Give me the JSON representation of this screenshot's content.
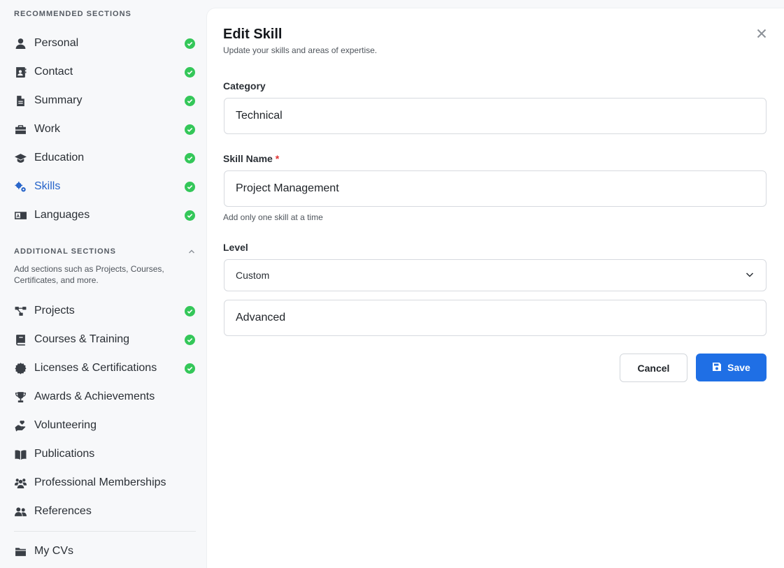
{
  "sidebar": {
    "recommended_heading": "RECOMMENDED SECTIONS",
    "recommended": [
      {
        "label": "Personal",
        "icon": "user-icon",
        "done": true
      },
      {
        "label": "Contact",
        "icon": "contact-card-icon",
        "done": true
      },
      {
        "label": "Summary",
        "icon": "document-icon",
        "done": true
      },
      {
        "label": "Work",
        "icon": "briefcase-icon",
        "done": true
      },
      {
        "label": "Education",
        "icon": "graduation-cap-icon",
        "done": true
      },
      {
        "label": "Skills",
        "icon": "gears-icon",
        "done": true,
        "active": true
      },
      {
        "label": "Languages",
        "icon": "language-icon",
        "done": true
      }
    ],
    "additional_heading": "ADDITIONAL SECTIONS",
    "additional_description": "Add sections such as Projects, Courses, Certificates, and more.",
    "additional": [
      {
        "label": "Projects",
        "icon": "project-diagram-icon",
        "done": true
      },
      {
        "label": "Courses & Training",
        "icon": "book-icon",
        "done": true
      },
      {
        "label": "Licenses & Certifications",
        "icon": "certificate-icon",
        "done": true
      },
      {
        "label": "Awards & Achievements",
        "icon": "trophy-icon",
        "done": false
      },
      {
        "label": "Volunteering",
        "icon": "hand-holding-heart-icon",
        "done": false
      },
      {
        "label": "Publications",
        "icon": "open-book-icon",
        "done": false
      },
      {
        "label": "Professional Memberships",
        "icon": "users-group-icon",
        "done": false
      },
      {
        "label": "References",
        "icon": "people-icon",
        "done": false
      }
    ],
    "footer_item": {
      "label": "My CVs",
      "icon": "folder-icon"
    }
  },
  "modal": {
    "title": "Edit Skill",
    "subtitle": "Update your skills and areas of expertise.",
    "category_label": "Category",
    "category_value": "Technical",
    "skill_name_label": "Skill Name",
    "required_marker": "*",
    "skill_name_value": "Project Management",
    "skill_hint": "Add only one skill at a time",
    "level_label": "Level",
    "level_select_value": "Custom",
    "level_custom_value": "Advanced",
    "cancel_label": "Cancel",
    "save_label": "Save"
  },
  "colors": {
    "accent": "#1f6fe5",
    "active_nav": "#2563c9",
    "check": "#34c759",
    "required": "#e03131"
  }
}
